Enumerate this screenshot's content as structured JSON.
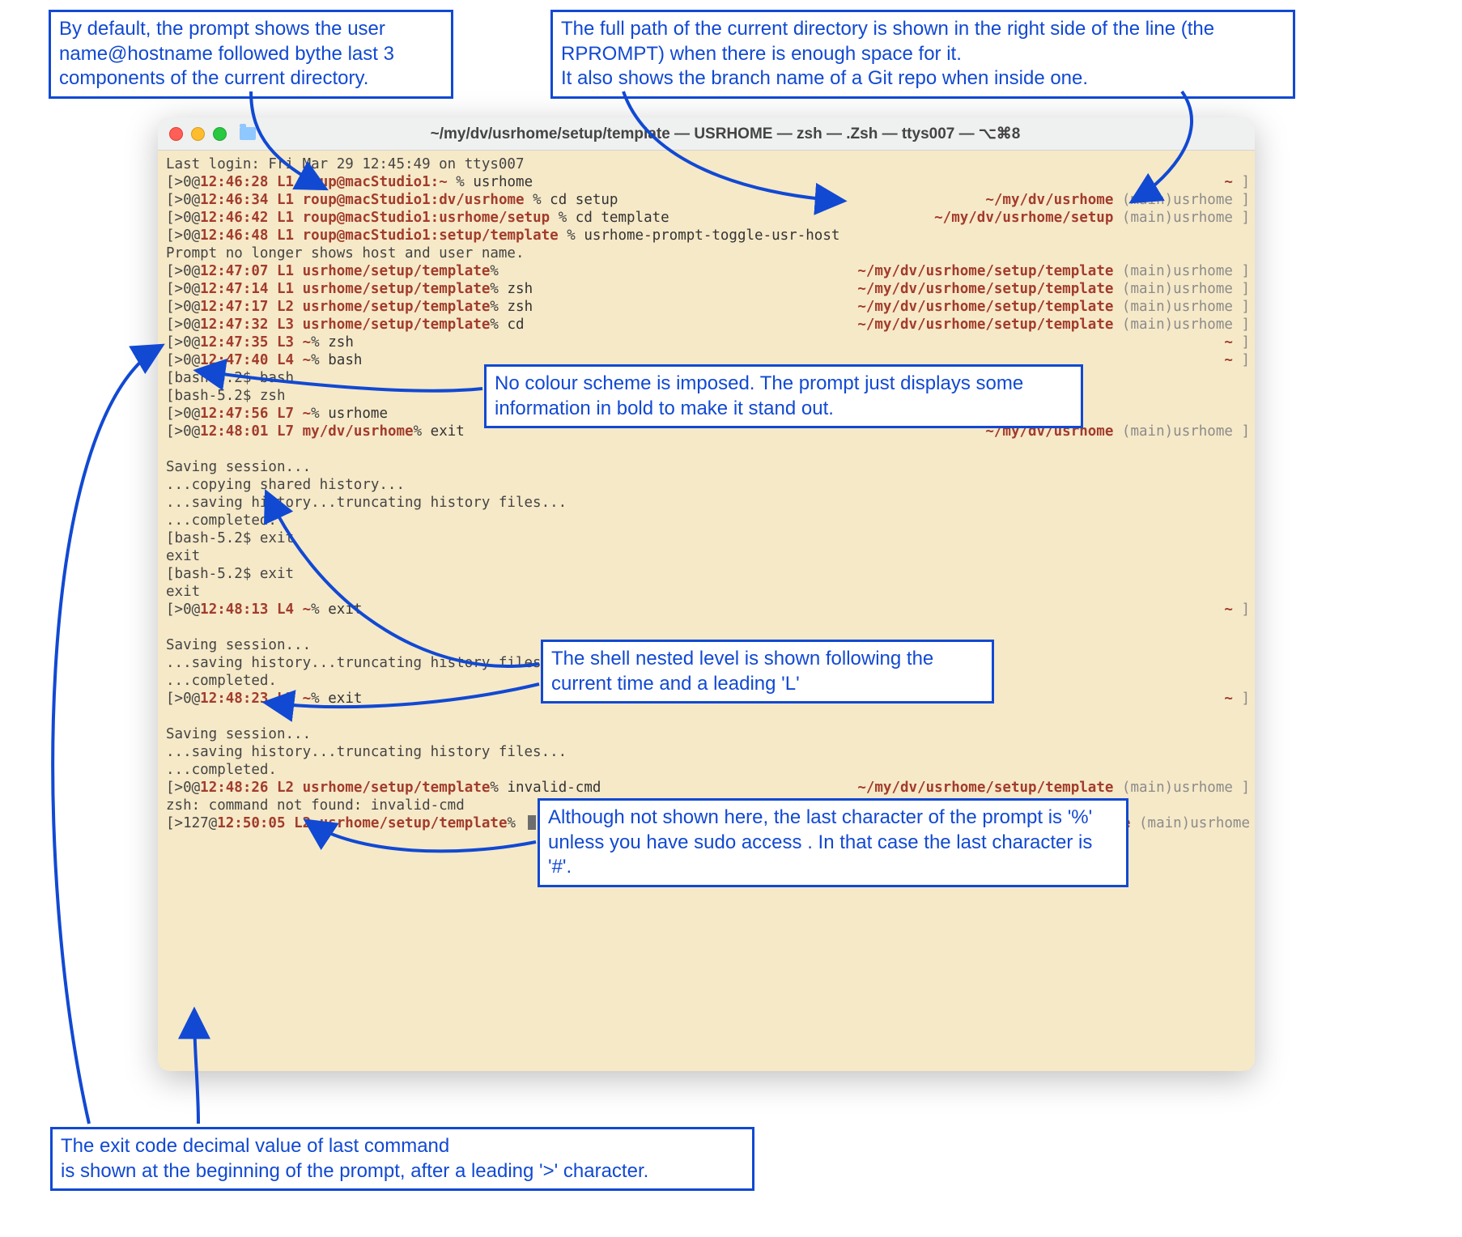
{
  "callouts": {
    "topLeft": "By default, the  prompt shows the user name@hostname followed bythe last 3 components of the current directory.",
    "topRight": "The full path of the current directory is shown in the right side of the line (the RPROMPT) when there is enough space for it.\nIt also shows the branch name of a Git repo when inside one.",
    "mid": "No colour scheme is imposed. The prompt just displays some information in bold to make it stand out.",
    "nested": "The shell nested level is shown following the current time and a leading 'L'",
    "sudo": "Although not shown here, the last character of the prompt is '%' unless you have sudo access .  In that case the last character is '#'.",
    "bottom": "The exit code decimal value of last command\nis  shown at the beginning of the prompt, after a leading '>' character."
  },
  "titlebar": {
    "title": "~/my/dv/usrhome/setup/template — USRHOME — zsh — .Zsh — ttys007 — ⌥⌘8"
  },
  "lines": [
    {
      "kind": "plain",
      "text": "Last login: Fri Mar 29 12:45:49 on ttys007"
    },
    {
      "kind": "prompt",
      "exit": ">0@",
      "time": "12:46:28",
      "lvl": "L1",
      "host": "roup@macStudio1:~",
      "ps": " % ",
      "cmd": "usrhome",
      "rpath": "",
      "branch": "",
      "rlabel": "",
      "tilde": "~",
      "bracket": " ]"
    },
    {
      "kind": "prompt",
      "exit": ">0@",
      "time": "12:46:34",
      "lvl": "L1",
      "host": "roup@macStudio1:dv/usrhome",
      "ps": " % ",
      "cmd": "cd setup",
      "rpath": "~/my/dv/usrhome",
      "branch": " (main)",
      "rlabel": "usrhome",
      "tilde": "",
      "bracket": " ]"
    },
    {
      "kind": "prompt",
      "exit": ">0@",
      "time": "12:46:42",
      "lvl": "L1",
      "host": "roup@macStudio1:usrhome/setup",
      "ps": " % ",
      "cmd": "cd template",
      "rpath": "~/my/dv/usrhome/setup",
      "branch": " (main)",
      "rlabel": "usrhome",
      "tilde": "",
      "bracket": " ]"
    },
    {
      "kind": "prompt",
      "exit": ">0@",
      "time": "12:46:48",
      "lvl": "L1",
      "host": "roup@macStudio1:setup/template",
      "ps": " % ",
      "cmd": "usrhome-prompt-toggle-usr-host",
      "rpath": "",
      "branch": "",
      "rlabel": "",
      "tilde": "",
      "bracket": ""
    },
    {
      "kind": "plain",
      "text": "Prompt no longer shows host and user name."
    },
    {
      "kind": "prompt",
      "exit": ">0@",
      "time": "12:47:07",
      "lvl": "L1",
      "host": "usrhome/setup/template",
      "ps": "% ",
      "cmd": "",
      "rpath": "~/my/dv/usrhome/setup/template",
      "branch": " (main)",
      "rlabel": "usrhome",
      "tilde": "",
      "bracket": " ]"
    },
    {
      "kind": "prompt",
      "exit": ">0@",
      "time": "12:47:14",
      "lvl": "L1",
      "host": "usrhome/setup/template",
      "ps": "% ",
      "cmd": "zsh",
      "rpath": "~/my/dv/usrhome/setup/template",
      "branch": " (main)",
      "rlabel": "usrhome",
      "tilde": "",
      "bracket": " ]"
    },
    {
      "kind": "prompt",
      "exit": ">0@",
      "time": "12:47:17",
      "lvl": "L2",
      "host": "usrhome/setup/template",
      "ps": "% ",
      "cmd": "zsh",
      "rpath": "~/my/dv/usrhome/setup/template",
      "branch": " (main)",
      "rlabel": "usrhome",
      "tilde": "",
      "bracket": " ]"
    },
    {
      "kind": "prompt",
      "exit": ">0@",
      "time": "12:47:32",
      "lvl": "L3",
      "host": "usrhome/setup/template",
      "ps": "% ",
      "cmd": "cd",
      "rpath": "~/my/dv/usrhome/setup/template",
      "branch": " (main)",
      "rlabel": "usrhome",
      "tilde": "",
      "bracket": " ]"
    },
    {
      "kind": "prompt",
      "exit": ">0@",
      "time": "12:47:35",
      "lvl": "L3",
      "host": "~",
      "ps": "% ",
      "cmd": "zsh",
      "rpath": "",
      "branch": "",
      "rlabel": "",
      "tilde": "~",
      "bracket": " ]"
    },
    {
      "kind": "prompt",
      "exit": ">0@",
      "time": "12:47:40",
      "lvl": "L4",
      "host": "~",
      "ps": "% ",
      "cmd": "bash",
      "rpath": "",
      "branch": "",
      "rlabel": "",
      "tilde": "~",
      "bracket": " ]"
    },
    {
      "kind": "bash",
      "text": "[bash-5.2$ bash"
    },
    {
      "kind": "bash",
      "text": "[bash-5.2$ zsh"
    },
    {
      "kind": "prompt",
      "exit": ">0@",
      "time": "12:47:56",
      "lvl": "L7",
      "host": "~",
      "ps": "% ",
      "cmd": "usrhome",
      "rpath": "",
      "branch": "",
      "rlabel": "",
      "tilde": "",
      "bracket": ""
    },
    {
      "kind": "prompt",
      "exit": ">0@",
      "time": "12:48:01",
      "lvl": "L7",
      "host": "my/dv/usrhome",
      "ps": "% ",
      "cmd": "exit",
      "rpath": "~/my/dv/usrhome",
      "branch": " (main)",
      "rlabel": "usrhome",
      "tilde": "",
      "bracket": " ]"
    },
    {
      "kind": "blank"
    },
    {
      "kind": "plain",
      "text": "Saving session..."
    },
    {
      "kind": "plain",
      "text": "...copying shared history..."
    },
    {
      "kind": "plain",
      "text": "...saving history...truncating history files..."
    },
    {
      "kind": "plain",
      "text": "...completed."
    },
    {
      "kind": "bash",
      "text": "[bash-5.2$ exit"
    },
    {
      "kind": "plain",
      "text": "exit"
    },
    {
      "kind": "bash",
      "text": "[bash-5.2$ exit"
    },
    {
      "kind": "plain",
      "text": "exit"
    },
    {
      "kind": "prompt",
      "exit": ">0@",
      "time": "12:48:13",
      "lvl": "L4",
      "host": "~",
      "ps": "% ",
      "cmd": "exit",
      "rpath": "",
      "branch": "",
      "rlabel": "",
      "tilde": "~",
      "bracket": " ]"
    },
    {
      "kind": "blank"
    },
    {
      "kind": "plain",
      "text": "Saving session..."
    },
    {
      "kind": "plain",
      "text": "...saving history...truncating history files..."
    },
    {
      "kind": "plain",
      "text": "...completed."
    },
    {
      "kind": "prompt",
      "exit": ">0@",
      "time": "12:48:23",
      "lvl": "L3",
      "host": "~",
      "ps": "% ",
      "cmd": "exit",
      "rpath": "",
      "branch": "",
      "rlabel": "",
      "tilde": "~",
      "bracket": " ]"
    },
    {
      "kind": "blank"
    },
    {
      "kind": "plain",
      "text": "Saving session..."
    },
    {
      "kind": "plain",
      "text": "...saving history...truncating history files..."
    },
    {
      "kind": "plain",
      "text": "...completed."
    },
    {
      "kind": "prompt",
      "exit": ">0@",
      "time": "12:48:26",
      "lvl": "L2",
      "host": "usrhome/setup/template",
      "ps": "% ",
      "cmd": "invalid-cmd",
      "rpath": "~/my/dv/usrhome/setup/template",
      "branch": " (main)",
      "rlabel": "usrhome",
      "tilde": "",
      "bracket": " ]"
    },
    {
      "kind": "plain",
      "text": "zsh: command not found: invalid-cmd"
    },
    {
      "kind": "prompt",
      "exit": ">127@",
      "time": "12:50:05",
      "lvl": "L2",
      "host": "usrhome/setup/template",
      "ps": "% ",
      "cmd": "▮",
      "rpath": "~/my/dv/usrhome/setup/template",
      "branch": " (main)",
      "rlabel": "usrhome",
      "tilde": "",
      "bracket": "",
      "cursor": true
    }
  ]
}
